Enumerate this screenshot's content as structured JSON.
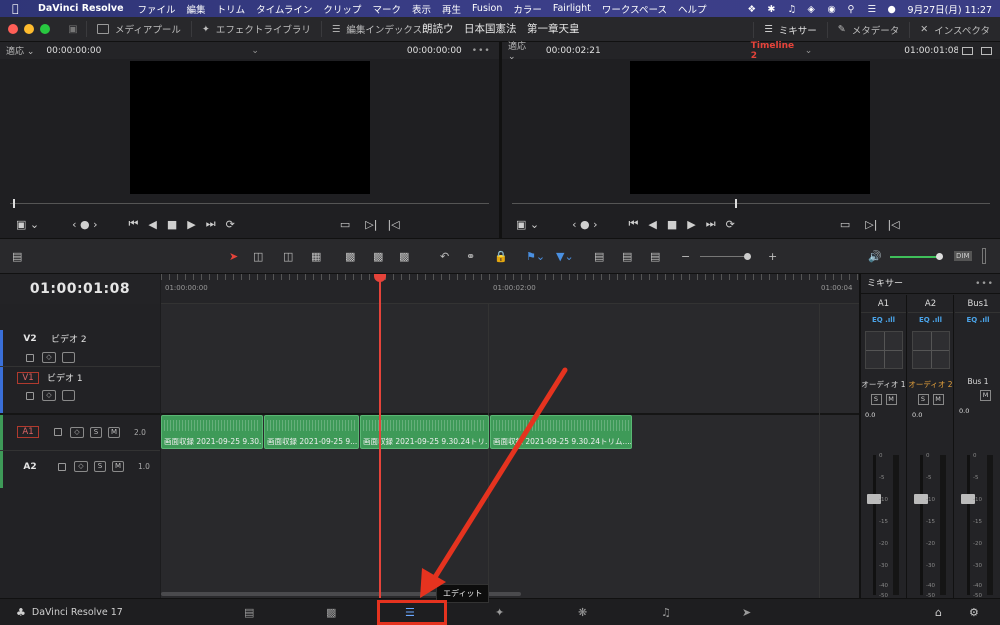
{
  "menubar": {
    "app_name": "DaVinci Resolve",
    "items": [
      "ファイル",
      "編集",
      "トリム",
      "タイムライン",
      "クリップ",
      "マーク",
      "表示",
      "再生",
      "Fusion",
      "カラー",
      "Fairlight",
      "ワークスペース",
      "ヘルプ"
    ],
    "datetime": "9月27日(月)  11:27"
  },
  "toolbar": {
    "media_pool": "メディアプール",
    "effects_library": "エフェクトライブラリ",
    "edit_index": "編集インデックス",
    "project_title": "朗読ウ　日本国憲法　第一章天皇",
    "mixer": "ミキサー",
    "metadata": "メタデータ",
    "inspector": "インスペクタ"
  },
  "source_viewer": {
    "fit": "適応",
    "timecode_left": "00:00:00:00",
    "timecode_right": "00:00:00:00"
  },
  "timeline_viewer": {
    "fit": "適応",
    "timecode_left": "00:00:02:21",
    "timeline_name": "Timeline 2",
    "timecode_right": "01:00:01:08"
  },
  "timeline": {
    "current_timecode": "01:00:01:08",
    "ruler_labels": [
      "01:00:00:00",
      "01:00:02:00",
      "01:00:04"
    ],
    "tracks": [
      {
        "id": "V2",
        "name": "ビデオ 2"
      },
      {
        "id": "V1",
        "name": "ビデオ 1"
      },
      {
        "id": "A1",
        "level": "2.0"
      },
      {
        "id": "A2",
        "level": "1.0"
      }
    ],
    "clips": [
      "画面収録 2021-09-25 9.30....",
      "画面収録 2021-09-25 9....",
      "画面収録 2021-09-25 9.30.24トリ...",
      "画面収録 2021-09-25 9.30.24トリム...."
    ]
  },
  "mixer": {
    "title": "ミキサー",
    "channels": [
      {
        "name": "A1",
        "label": "オーディオ 1",
        "label_color": "#dddddd"
      },
      {
        "name": "A2",
        "label": "オーディオ 2",
        "label_color": "#e6a23c"
      },
      {
        "name": "Bus1",
        "label": "Bus 1",
        "label_color": "#dddddd"
      }
    ],
    "eq_label": "EQ",
    "solo": "S",
    "mute": "M",
    "level": "0.0",
    "scale": [
      "0",
      "-5",
      "-10",
      "-15",
      "-20",
      "-30",
      "-40",
      "-50"
    ]
  },
  "pagebar": {
    "brand": "DaVinci Resolve 17",
    "tooltip": "エディット"
  },
  "colors": {
    "accent_red": "#e5433a",
    "clip_green": "#3e9a58",
    "annotation_red": "#e5331f"
  }
}
